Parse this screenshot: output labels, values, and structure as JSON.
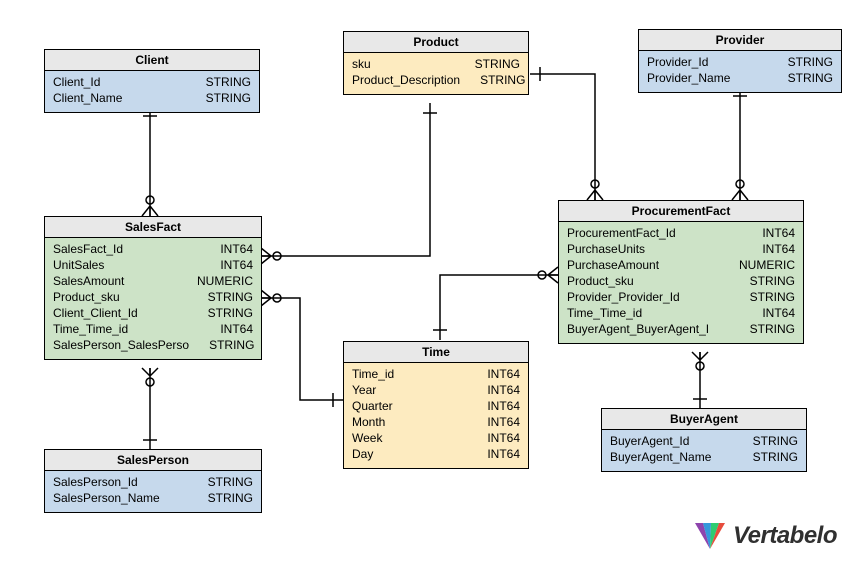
{
  "logo": {
    "text": "Vertabelo"
  },
  "entities": {
    "client": {
      "name": "Client",
      "cols": [
        {
          "n": "Client_Id",
          "t": "STRING"
        },
        {
          "n": "Client_Name",
          "t": "STRING"
        }
      ]
    },
    "product": {
      "name": "Product",
      "cols": [
        {
          "n": "sku",
          "t": "STRING"
        },
        {
          "n": "Product_Description",
          "t": "STRING"
        }
      ]
    },
    "provider": {
      "name": "Provider",
      "cols": [
        {
          "n": "Provider_Id",
          "t": "STRING"
        },
        {
          "n": "Provider_Name",
          "t": "STRING"
        }
      ]
    },
    "salesfact": {
      "name": "SalesFact",
      "cols": [
        {
          "n": "SalesFact_Id",
          "t": "INT64"
        },
        {
          "n": "UnitSales",
          "t": "INT64"
        },
        {
          "n": "SalesAmount",
          "t": "NUMERIC"
        },
        {
          "n": "Product_sku",
          "t": "STRING"
        },
        {
          "n": "Client_Client_Id",
          "t": "STRING"
        },
        {
          "n": "Time_Time_id",
          "t": "INT64"
        },
        {
          "n": "SalesPerson_SalesPerso",
          "t": "STRING"
        }
      ]
    },
    "procurementfact": {
      "name": "ProcurementFact",
      "cols": [
        {
          "n": "ProcurementFact_Id",
          "t": "INT64"
        },
        {
          "n": "PurchaseUnits",
          "t": "INT64"
        },
        {
          "n": "PurchaseAmount",
          "t": "NUMERIC"
        },
        {
          "n": "Product_sku",
          "t": "STRING"
        },
        {
          "n": "Provider_Provider_Id",
          "t": "STRING"
        },
        {
          "n": "Time_Time_id",
          "t": "INT64"
        },
        {
          "n": "BuyerAgent_BuyerAgent_I",
          "t": "STRING"
        }
      ]
    },
    "time": {
      "name": "Time",
      "cols": [
        {
          "n": "Time_id",
          "t": "INT64"
        },
        {
          "n": "Year",
          "t": "INT64"
        },
        {
          "n": "Quarter",
          "t": "INT64"
        },
        {
          "n": "Month",
          "t": "INT64"
        },
        {
          "n": "Week",
          "t": "INT64"
        },
        {
          "n": "Day",
          "t": "INT64"
        }
      ]
    },
    "salesperson": {
      "name": "SalesPerson",
      "cols": [
        {
          "n": "SalesPerson_Id",
          "t": "STRING"
        },
        {
          "n": "SalesPerson_Name",
          "t": "STRING"
        }
      ]
    },
    "buyeragent": {
      "name": "BuyerAgent",
      "cols": [
        {
          "n": "BuyerAgent_Id",
          "t": "STRING"
        },
        {
          "n": "BuyerAgent_Name",
          "t": "STRING"
        }
      ]
    }
  },
  "relationships": [
    {
      "from": "client",
      "to": "salesfact",
      "from_card": "one",
      "to_card": "many"
    },
    {
      "from": "salesperson",
      "to": "salesfact",
      "from_card": "one",
      "to_card": "many"
    },
    {
      "from": "product",
      "to": "salesfact",
      "from_card": "one",
      "to_card": "many"
    },
    {
      "from": "product",
      "to": "procurementfact",
      "from_card": "one",
      "to_card": "many"
    },
    {
      "from": "provider",
      "to": "procurementfact",
      "from_card": "one",
      "to_card": "many"
    },
    {
      "from": "time",
      "to": "salesfact",
      "from_card": "one",
      "to_card": "many"
    },
    {
      "from": "time",
      "to": "procurementfact",
      "from_card": "one",
      "to_card": "many"
    },
    {
      "from": "buyeragent",
      "to": "procurementfact",
      "from_card": "one",
      "to_card": "many"
    }
  ]
}
